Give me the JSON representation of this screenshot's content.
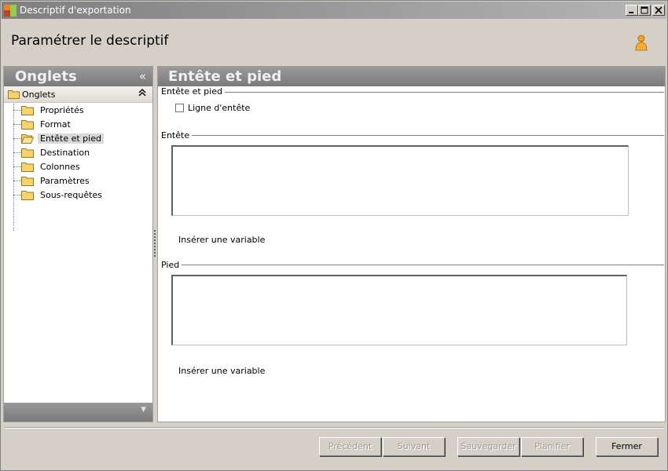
{
  "window": {
    "title": "Descriptif d'exportation"
  },
  "header": {
    "title": "Paramétrer le descriptif"
  },
  "left_panel": {
    "title": "Onglets",
    "collapse_glyph": "«",
    "group": {
      "label": "Onglets",
      "toggle_glyph": "⌃"
    },
    "items": [
      {
        "label": "Propriétés",
        "icon": "folder-icon",
        "selected": false
      },
      {
        "label": "Format",
        "icon": "folder-icon",
        "selected": false
      },
      {
        "label": "Entête et pied",
        "icon": "folder-open-icon",
        "selected": true
      },
      {
        "label": "Destination",
        "icon": "folder-icon",
        "selected": false
      },
      {
        "label": "Colonnes",
        "icon": "folder-icon",
        "selected": false
      },
      {
        "label": "Paramètres",
        "icon": "folder-icon",
        "selected": false
      },
      {
        "label": "Sous-requêtes",
        "icon": "folder-icon",
        "selected": false
      }
    ],
    "footer_glyph": "▼"
  },
  "right_panel": {
    "title": "Entête et pied",
    "section_header_footer": {
      "legend": "Entête et pied",
      "checkbox_label": "Ligne d'entête",
      "checked": false
    },
    "section_entete": {
      "legend": "Entête",
      "value": "",
      "insert_variable": "Insérer une variable"
    },
    "section_pied": {
      "legend": "Pied",
      "value": "",
      "insert_variable": "Insérer une variable"
    }
  },
  "buttons": {
    "previous": {
      "label": "Précédent",
      "enabled": false
    },
    "next": {
      "label": "Suivant",
      "enabled": false
    },
    "save": {
      "label": "Sauvegarder",
      "enabled": false
    },
    "schedule": {
      "label": "Planifier",
      "enabled": false
    },
    "close": {
      "label": "Fermer",
      "enabled": true
    }
  }
}
